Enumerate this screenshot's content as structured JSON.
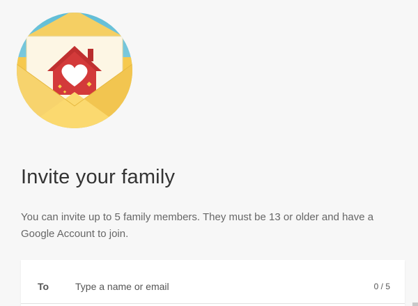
{
  "invite": {
    "title": "Invite your family",
    "description": "You can invite up to 5 family members. They must be 13 or older and have a Google Account to join."
  },
  "recipients": {
    "to_label": "To",
    "placeholder": "Type a name or email",
    "count_label": "0 / 5"
  },
  "illustration": {
    "icon": "envelope-house-heart-icon",
    "colors": {
      "sky": "#6cc3d8",
      "envelope": "#fbd66a",
      "house": "#d33a3a",
      "heart": "#ffffff"
    }
  }
}
